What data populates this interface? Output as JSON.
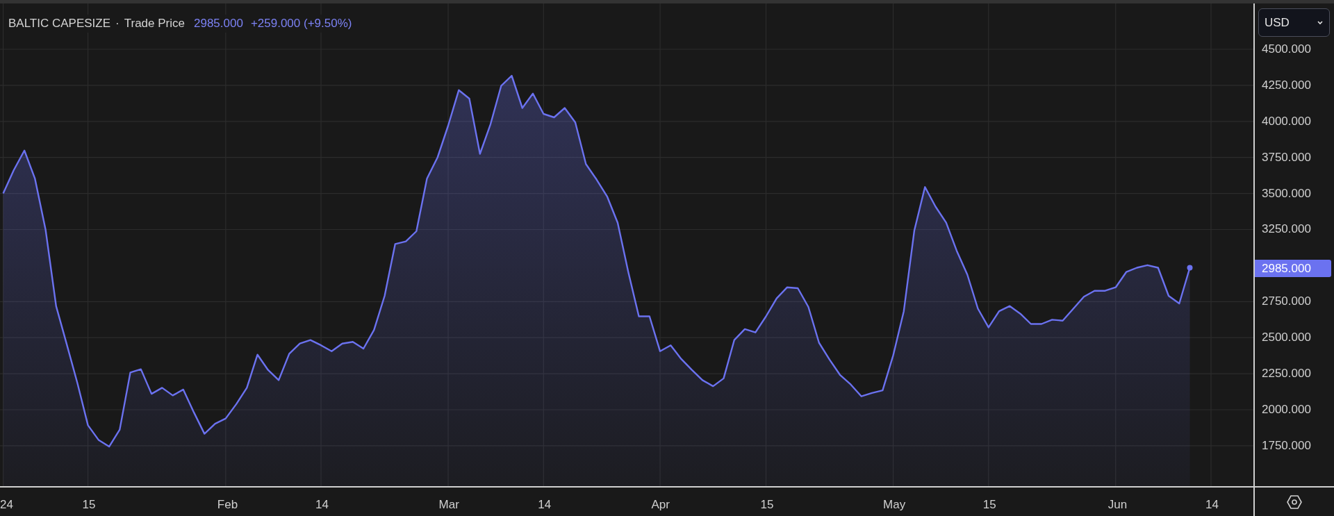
{
  "legend": {
    "symbol": "BALTIC CAPESIZE",
    "separator": "·",
    "last": "2985.000",
    "change": "+259.000 (+9.50%)"
  },
  "currency_dropdown": {
    "value": "USD"
  },
  "price_axis": {
    "last_price_label": "2985.000"
  },
  "chart_data": {
    "type": "area",
    "grid": true,
    "ylim": [
      1470,
      4818
    ],
    "categories": [
      "24",
      null,
      null,
      null,
      null,
      null,
      null,
      null,
      "15",
      null,
      null,
      null,
      null,
      null,
      null,
      null,
      null,
      null,
      null,
      null,
      null,
      "Feb",
      null,
      null,
      null,
      null,
      null,
      null,
      null,
      null,
      "14",
      null,
      null,
      null,
      null,
      null,
      null,
      null,
      null,
      null,
      null,
      null,
      "Mar",
      null,
      null,
      null,
      null,
      null,
      null,
      null,
      null,
      "14",
      null,
      null,
      null,
      null,
      null,
      null,
      null,
      null,
      null,
      null,
      "Apr",
      null,
      null,
      null,
      null,
      null,
      null,
      null,
      null,
      null,
      "15",
      null,
      null,
      null,
      null,
      null,
      null,
      null,
      null,
      null,
      null,
      null,
      "May",
      null,
      null,
      null,
      null,
      null,
      null,
      null,
      null,
      "15",
      null,
      null,
      null,
      null,
      null,
      null,
      null,
      null,
      null,
      null,
      null,
      "Jun",
      null,
      null,
      null,
      null,
      null,
      null,
      null,
      null,
      "14",
      null,
      null,
      null
    ],
    "yticks": [
      {
        "value": 4500,
        "label": "4500.000"
      },
      {
        "value": 4250,
        "label": "4250.000"
      },
      {
        "value": 4000,
        "label": "4000.000"
      },
      {
        "value": 3750,
        "label": "3750.000"
      },
      {
        "value": 3500,
        "label": "3500.000"
      },
      {
        "value": 3250,
        "label": "3250.000"
      },
      {
        "value": 2750,
        "label": "2750.000"
      },
      {
        "value": 2500,
        "label": "2500.000"
      },
      {
        "value": 2250,
        "label": "2250.000"
      },
      {
        "value": 2000,
        "label": "2000.000"
      },
      {
        "value": 1750,
        "label": "1750.000"
      }
    ],
    "series": [
      {
        "name": "Trade Price",
        "color": "#6b72f0",
        "values": [
          3500,
          3662,
          3798,
          3603,
          3249,
          2718,
          2453,
          2187,
          1892,
          1791,
          1744,
          1862,
          2258,
          2281,
          2110,
          2152,
          2099,
          2140,
          1981,
          1833,
          1903,
          1939,
          2039,
          2152,
          2382,
          2276,
          2205,
          2388,
          2459,
          2483,
          2447,
          2406,
          2459,
          2471,
          2424,
          2553,
          2790,
          3150,
          3167,
          3238,
          3603,
          3751,
          3970,
          4217,
          4158,
          3775,
          3981,
          4246,
          4317,
          4093,
          4193,
          4052,
          4028,
          4093,
          3993,
          3704,
          3598,
          3480,
          3297,
          2955,
          2648,
          2648,
          2406,
          2447,
          2352,
          2276,
          2205,
          2163,
          2217,
          2483,
          2559,
          2536,
          2648,
          2772,
          2849,
          2843,
          2713,
          2465,
          2347,
          2240,
          2175,
          2093,
          2116,
          2134,
          2376,
          2683,
          3244,
          3545,
          3409,
          3297,
          3102,
          2937,
          2701,
          2571,
          2683,
          2719,
          2666,
          2595,
          2595,
          2624,
          2618,
          2701,
          2784,
          2825,
          2825,
          2849,
          2955,
          2985,
          3003,
          2985,
          2790,
          2737,
          2985,
          null,
          null,
          null,
          null,
          null
        ]
      }
    ]
  }
}
